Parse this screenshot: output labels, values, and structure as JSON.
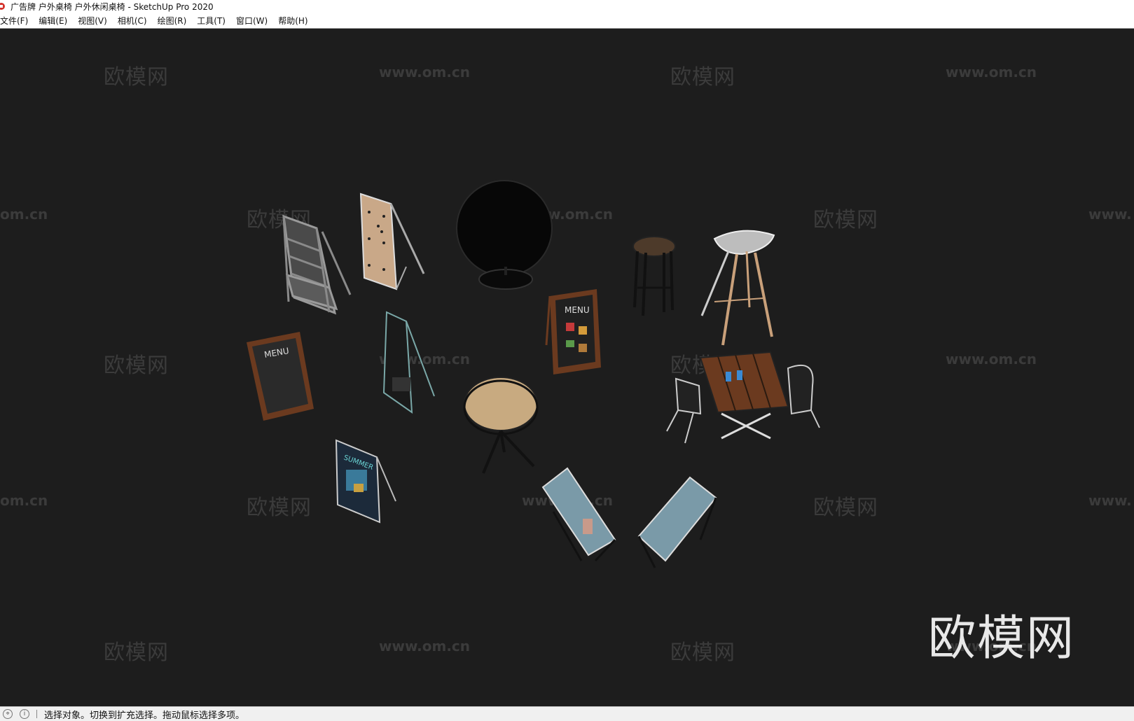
{
  "window": {
    "title": "广告牌 户外桌椅 户外休闲桌椅 - SketchUp Pro 2020"
  },
  "menu": {
    "items": [
      {
        "label": "文件(F)"
      },
      {
        "label": "编辑(E)"
      },
      {
        "label": "视图(V)"
      },
      {
        "label": "相机(C)"
      },
      {
        "label": "绘图(R)"
      },
      {
        "label": "工具(T)"
      },
      {
        "label": "窗口(W)"
      },
      {
        "label": "帮助(H)"
      }
    ]
  },
  "viewport": {
    "background": "#1d1d1d",
    "watermark_cn": "欧模网",
    "watermark_url": "www.om.cn",
    "watermark_url_left": "om.cn",
    "watermark_url_right": "www.",
    "logo": "欧模网",
    "sign_text_menu": "MENU",
    "sign_text_summer": "SUMMER"
  },
  "status": {
    "text": "选择对象。切换到扩充选择。拖动鼠标选择多项。"
  },
  "colors": {
    "accent": "#d4322c",
    "wood": "#6b3a1f",
    "plywood": "#c9a888"
  }
}
